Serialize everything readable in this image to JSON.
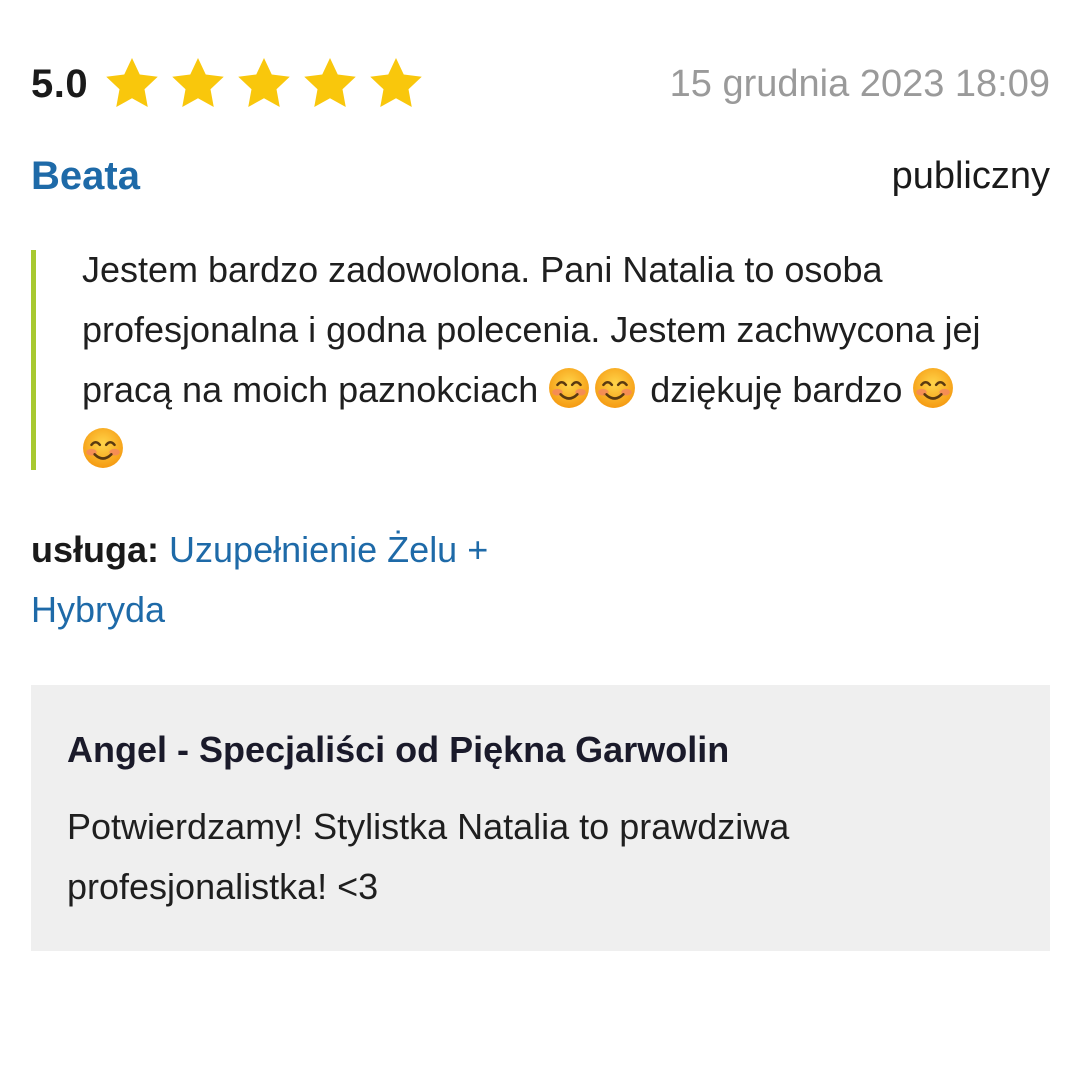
{
  "review": {
    "score": "5.0",
    "stars": 5,
    "star_color": "#f9c70c",
    "date": "15 grudnia 2023 18:09",
    "author": "Beata",
    "visibility": "publiczny",
    "text_part1": "Jestem bardzo zadowolona. Pani Natalia to osoba profesjonalna i godna polecenia. Jestem zachwycona jej pracą na moich paznokciach ",
    "text_part2": " dziękuję bardzo ",
    "emoji_icon": "smiling-face-icon",
    "service_label": "usługa:",
    "service_name": "Uzupełnienie Żelu + Hybryda"
  },
  "reply": {
    "author": "Angel - Specjaliści od Piękna Garwolin",
    "text": "Potwierdzamy! Stylistka Natalia to prawdziwa profesjonalistka! <3"
  },
  "colors": {
    "accent_link": "#1e6aa8",
    "quote_bar": "#a8c930",
    "date_gray": "#9a9a9a",
    "reply_bg": "#efefef"
  }
}
